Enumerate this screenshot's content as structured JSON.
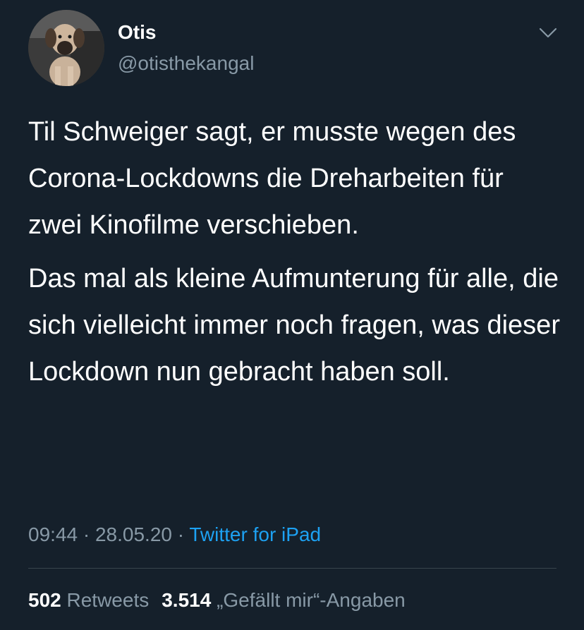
{
  "tweet": {
    "author": {
      "display_name": "Otis",
      "handle": "@otisthekangal",
      "avatar_icon": "puppy-avatar"
    },
    "menu_icon": "chevron-down-icon",
    "text_paragraphs": [
      "Til Schweiger sagt, er musste wegen des Corona-Lockdowns die Dreharbeiten für zwei Kinofilme verschieben.",
      "Das mal als kleine Aufmunterung für alle, die sich vielleicht immer noch fragen, was dieser Lockdown nun gebracht haben soll."
    ],
    "time": "09:44",
    "separator": " · ",
    "date": "28.05.20",
    "source": "Twitter for iPad",
    "retweets_count": "502",
    "retweets_label": "Retweets",
    "likes_count": "3.514",
    "likes_label": "„Gefällt mir“-Angaben"
  },
  "colors": {
    "background": "#15202b",
    "primary_text": "#ffffff",
    "secondary_text": "#8899a6",
    "accent": "#1da1f2",
    "divider": "#38444d"
  }
}
